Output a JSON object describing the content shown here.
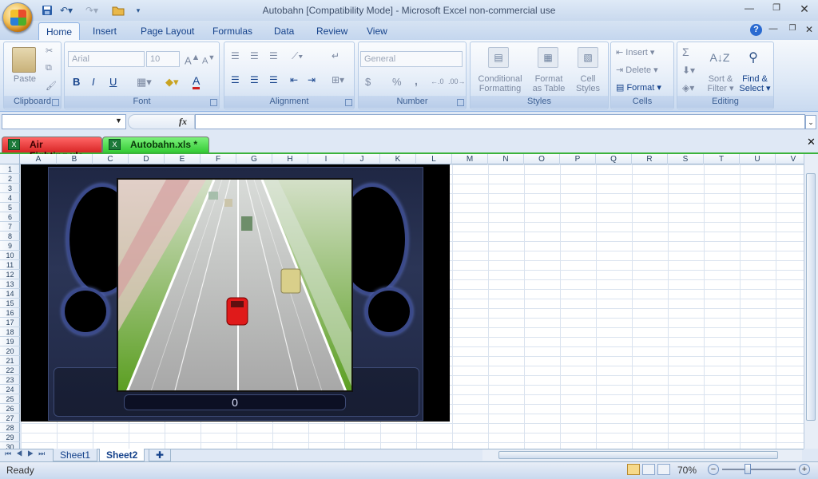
{
  "window": {
    "title": "Autobahn  [Compatibility Mode] - Microsoft Excel non-commercial use"
  },
  "ribbon_tabs": [
    "Home",
    "Insert",
    "Page Layout",
    "Formulas",
    "Data",
    "Review",
    "View"
  ],
  "ribbon": {
    "clipboard": {
      "label": "Clipboard",
      "paste": "Paste"
    },
    "font": {
      "label": "Font",
      "name": "Arial",
      "size": "10",
      "bold": "B",
      "italic": "I",
      "underline": "U"
    },
    "alignment": {
      "label": "Alignment"
    },
    "number": {
      "label": "Number",
      "format": "General",
      "currency": "$",
      "percent": "%",
      "comma": ","
    },
    "styles": {
      "label": "Styles",
      "conditional_1": "Conditional",
      "conditional_2": "Formatting",
      "format_table_1": "Format",
      "format_table_2": "as Table",
      "cell_styles_1": "Cell",
      "cell_styles_2": "Styles"
    },
    "cells": {
      "label": "Cells",
      "insert": "Insert",
      "delete": "Delete",
      "format": "Format"
    },
    "editing": {
      "label": "Editing",
      "sigma": "Σ",
      "sort_1": "Sort &",
      "sort_2": "Filter",
      "find_1": "Find &",
      "find_2": "Select"
    }
  },
  "formula_bar": {
    "fx": "fx",
    "name_box": "",
    "content": ""
  },
  "workbooks": [
    {
      "name": "Air Fighting.xls",
      "color": "#ea3b3b"
    },
    {
      "name": "Autobahn.xls  *",
      "color": "#3bd33b"
    }
  ],
  "columns": [
    "A",
    "B",
    "C",
    "D",
    "E",
    "F",
    "G",
    "H",
    "I",
    "J",
    "K",
    "L",
    "M",
    "N",
    "O",
    "P",
    "Q",
    "R",
    "S",
    "T",
    "U",
    "V"
  ],
  "rows": [
    "1",
    "2",
    "3",
    "4",
    "5",
    "6",
    "7",
    "8",
    "9",
    "10",
    "11",
    "12",
    "13",
    "14",
    "15",
    "16",
    "17",
    "18",
    "19",
    "20",
    "21",
    "22",
    "23",
    "24",
    "25",
    "26",
    "27",
    "28",
    "29",
    "30"
  ],
  "game": {
    "score": "0"
  },
  "sheets": [
    "Sheet1",
    "Sheet2"
  ],
  "active_sheet": "Sheet2",
  "status": {
    "ready": "Ready",
    "zoom": "70%"
  }
}
